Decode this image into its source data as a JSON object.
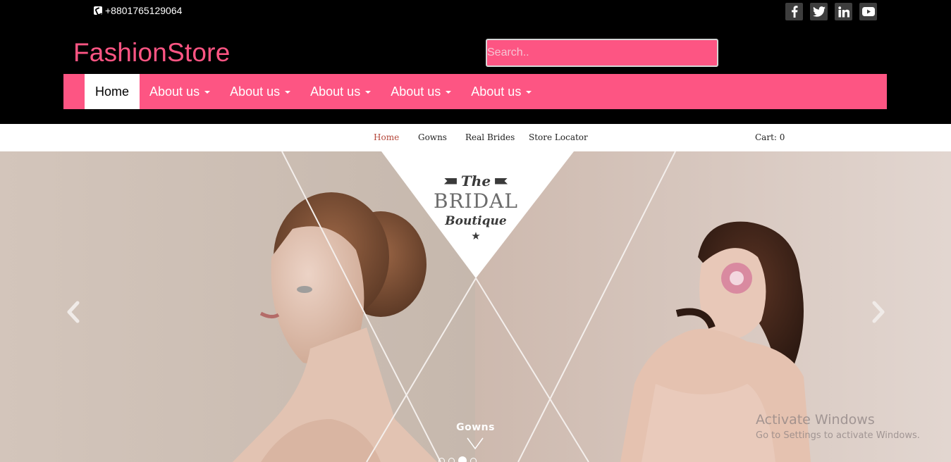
{
  "header": {
    "phone": "+8801765129064",
    "brand": "FashionStore",
    "search_placeholder": "Search..",
    "socials": [
      "facebook-icon",
      "twitter-icon",
      "linkedin-icon",
      "youtube-icon"
    ]
  },
  "nav": {
    "items": [
      {
        "label": "Home",
        "active": true,
        "dropdown": false
      },
      {
        "label": "About us",
        "active": false,
        "dropdown": true
      },
      {
        "label": "About us",
        "active": false,
        "dropdown": true
      },
      {
        "label": "About us",
        "active": false,
        "dropdown": true
      },
      {
        "label": "About us",
        "active": false,
        "dropdown": true
      },
      {
        "label": "About us",
        "active": false,
        "dropdown": true
      }
    ]
  },
  "subnav": {
    "items": [
      "Home",
      "Gowns",
      "Real Brides",
      "Store Locator"
    ],
    "cart": "Cart: 0"
  },
  "hero": {
    "logo_the": "The",
    "logo_main": "BRIDAL",
    "logo_sub": "Boutique",
    "caption": "Gowns",
    "slide_count": 4,
    "active_slide": 2
  },
  "watermark": {
    "line1": "Activate Windows",
    "line2": "Go to Settings to activate Windows."
  },
  "colors": {
    "accent": "#fd5583",
    "header_bg": "#000000",
    "active_sublink": "#b5473a"
  }
}
